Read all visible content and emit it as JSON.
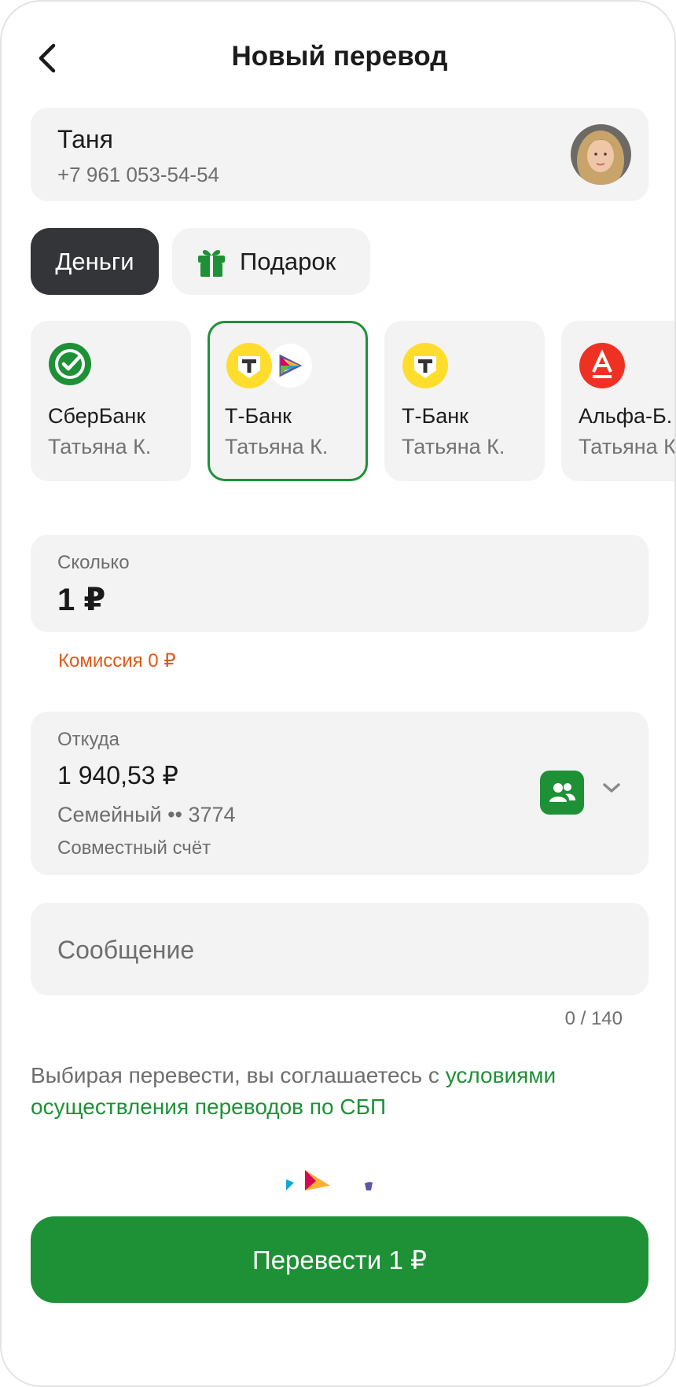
{
  "header": {
    "title": "Новый перевод",
    "back_icon": "chevron-left-icon"
  },
  "recipient": {
    "name": "Таня",
    "phone": "+7 961 053-54-54"
  },
  "transfer_types": [
    {
      "label": "Деньги",
      "selected": true
    },
    {
      "label": "Подарок",
      "icon": "gift-icon",
      "selected": false
    }
  ],
  "banks": [
    {
      "name": "СберБанк",
      "owner": "Татьяна К.",
      "selected": false
    },
    {
      "name": "Т-Банк",
      "owner": "Татьяна К.",
      "selected": true
    },
    {
      "name": "Т-Банк",
      "owner": "Татьяна К.",
      "selected": false
    },
    {
      "name": "Альфа-Б.",
      "owner": "Татьяна К",
      "selected": false
    }
  ],
  "amount": {
    "label": "Сколько",
    "value": "1 ₽"
  },
  "commission": "Комиссия 0 ₽",
  "source": {
    "label": "Откуда",
    "balance": "1 940,53 ₽",
    "account": "Семейный •• 3774",
    "type": "Совместный счёт"
  },
  "message": {
    "placeholder": "Сообщение",
    "counter": "0 / 140"
  },
  "terms": {
    "text": "Выбирая перевести, вы соглашаетесь с ",
    "link": "условиями осуществления переводов по СБП"
  },
  "submit": {
    "label": "Перевести 1 ₽"
  },
  "colors": {
    "accent": "#1e9137",
    "dark_pill": "#333538",
    "warning": "#e0591a",
    "card_bg": "#f3f3f3"
  }
}
